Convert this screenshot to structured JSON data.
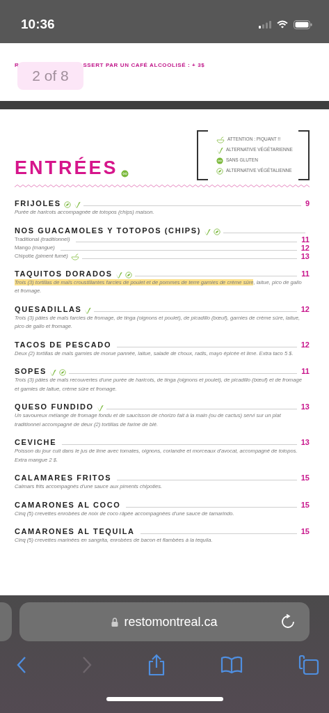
{
  "status_bar": {
    "time": "10:36"
  },
  "previous_page": {
    "texts": [
      "R",
      "SSERT PAR UN CAFÉ ALCOOLISÉ : + 3$"
    ]
  },
  "page_indicator": {
    "label": "2 of 8"
  },
  "section": {
    "title": "ENTRÉES",
    "title_icons": [
      {
        "kind": "gluten_free"
      }
    ],
    "legend": [
      {
        "kind": "spicy",
        "label": "ATTENTION : PIQUANT !!"
      },
      {
        "kind": "vegetarian",
        "label": "ALTERNATIVE VÉGÉTARIENNE"
      },
      {
        "kind": "gluten_free",
        "label": "SANS GLUTEN"
      },
      {
        "kind": "vegan",
        "label": "ALTERNATIVE VÉGÉTALIENNE"
      }
    ]
  },
  "items": [
    {
      "name": "FRIJOLES",
      "icons": [
        {
          "kind": "vegan"
        },
        {
          "kind": "vegetarian"
        }
      ],
      "price": "9",
      "description_parts": [
        {
          "text": "Purée de haricots accompagnée de totopos (chips) maison.",
          "highlighted": false
        }
      ]
    },
    {
      "name": "NOS GUACAMOLES Y TOTOPOS (CHIPS)",
      "icons": [
        {
          "kind": "vegetarian"
        },
        {
          "kind": "vegan"
        }
      ],
      "options": [
        {
          "label": "Traditional *(traditionnel)*",
          "price": "11"
        },
        {
          "label": "Mango *(mangue)*",
          "price": "12"
        },
        {
          "label": "Chipotle *(piment fumé)*",
          "icons": [
            {
              "kind": "spicy"
            }
          ],
          "price": "13"
        }
      ]
    },
    {
      "name": "TAQUITOS DORADOS",
      "icons": [
        {
          "kind": "vegetarian"
        },
        {
          "kind": "vegan"
        }
      ],
      "price": "11",
      "description_parts": [
        {
          "text": "Trois (3) tortillas de maïs croustillantes farcies de poulet et de pommes de terre garnies de crème sûre",
          "highlighted": true
        },
        {
          "text": ", laitue, pico de gallo et fromage.",
          "highlighted": false
        }
      ]
    },
    {
      "name": "QUESADILLAS",
      "icons": [
        {
          "kind": "vegetarian"
        }
      ],
      "price": "12",
      "description_parts": [
        {
          "text": "Trois (3) pâtes de maïs farcies de fromage, de tinga (oignons et poulet), de picadillo (bœuf), garnies de crème sûre, laitue, pico de gallo et fromage.",
          "highlighted": false
        }
      ]
    },
    {
      "name": "TACOS DE PESCADO",
      "price": "12",
      "description_parts": [
        {
          "text": "Deux (2)  tortillas de maïs garnies de morue pannée, laitue, salade de choux, radis, mayo épicée et lime. Extra taco 5 $.",
          "highlighted": false
        }
      ]
    },
    {
      "name": "SOPES",
      "icons": [
        {
          "kind": "vegetarian"
        },
        {
          "kind": "vegan"
        }
      ],
      "price": "11",
      "description_parts": [
        {
          "text": "Trois (3) pâtes de maïs recouvertes d'une purée de haricots, de tinga (oignons et poulet), de picadillo (bœuf) et de fromage et garnies de laitue, crème sûre et fromage.",
          "highlighted": false
        }
      ]
    },
    {
      "name": "QUESO FUNDIDO",
      "icons": [
        {
          "kind": "vegetarian"
        }
      ],
      "price": "13",
      "description_parts": [
        {
          "text": "Un savoureux mélange de fromage fondu et de saucisson de chorizo fait à la main (ou de cactus) servi sur un plat traditionnel accompagné de deux (2) tortillas de farine de blé.",
          "highlighted": false
        }
      ]
    },
    {
      "name": "CEVICHE",
      "price": "13",
      "description_parts": [
        {
          "text": "Poisson du jour cuit dans le jus de lime avec tomates, oignons, coriandre et morceaux d'avocat, accompagné de totopos. Extra mangue 2 $.",
          "highlighted": false
        }
      ]
    },
    {
      "name": "CALAMARES FRITOS",
      "price": "15",
      "description_parts": [
        {
          "text": "Calmars frits accompagnés d'une sauce aux piments chipotles.",
          "highlighted": false
        }
      ]
    },
    {
      "name": "CAMARONES AL COCO",
      "price": "15",
      "description_parts": [
        {
          "text": "Cinq (5) crevettes enrobées de noix de coco râpée accompagnées d'une sauce de tamarindo.",
          "highlighted": false
        }
      ]
    },
    {
      "name": "CAMARONES AL TEQUILA",
      "price": "15",
      "description_parts": [
        {
          "text": "Cinq (5) crevettes marinées en sangrita, enrobées de bacon et flambées à la tequila.",
          "highlighted": false
        }
      ]
    }
  ],
  "browser": {
    "url": "restomontreal.ca",
    "forward_disabled": true
  }
}
